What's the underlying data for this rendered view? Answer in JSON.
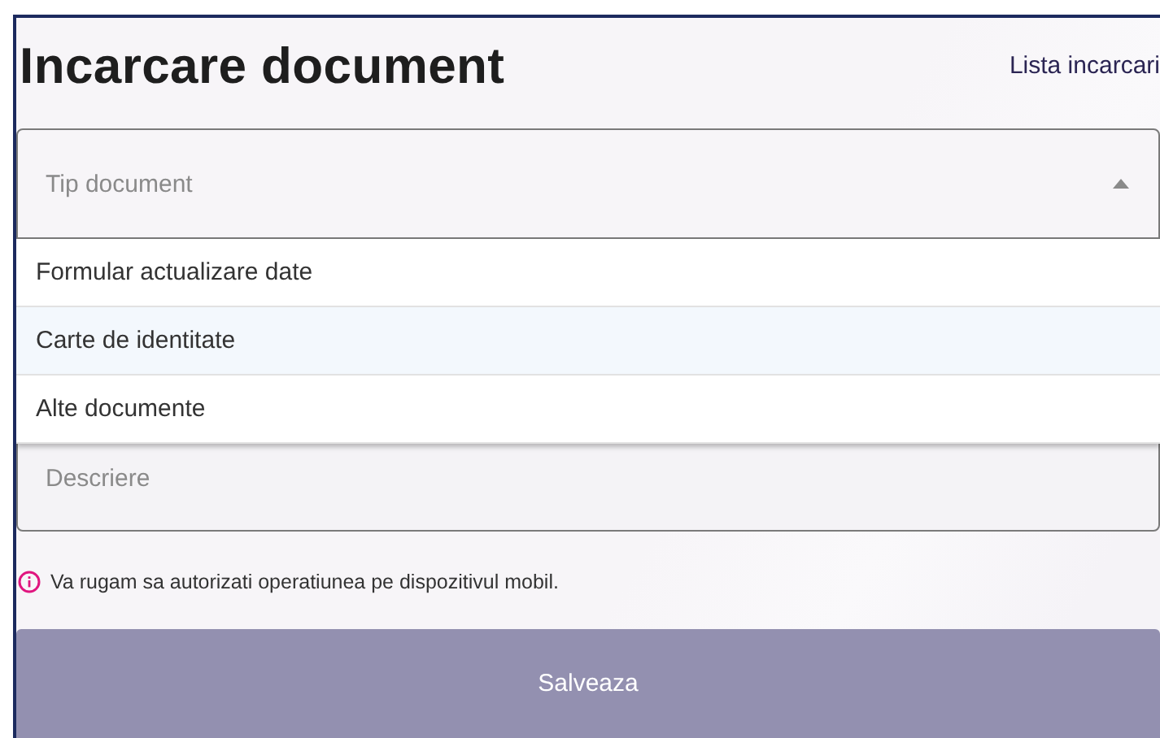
{
  "page": {
    "title": "Incarcare document",
    "link": "Lista incarcari"
  },
  "select": {
    "placeholder": "Tip document",
    "expanded": true,
    "options": [
      {
        "label": "Formular actualizare date",
        "selected": false
      },
      {
        "label": "Carte de identitate",
        "selected": true
      },
      {
        "label": "Alte documente",
        "selected": false
      }
    ]
  },
  "description": {
    "placeholder": "Descriere"
  },
  "notice": "Va rugam sa autorizati operatiunea pe dispozitivul mobil.",
  "button": {
    "label": "Salveaza",
    "disabled": true
  }
}
